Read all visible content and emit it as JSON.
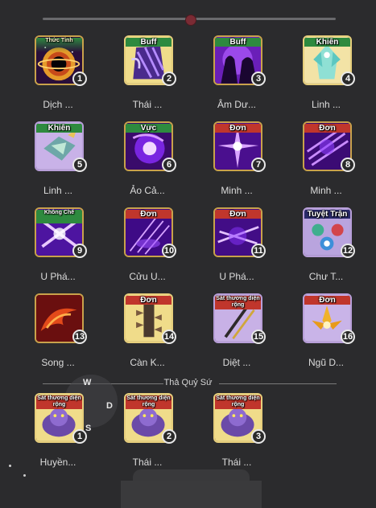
{
  "colors": {
    "background": "#2b2b2d",
    "badge_border": "#e8e8e8",
    "tile_border": "#c9a24b",
    "tag_red": "#c0362c",
    "tag_green": "#2e8a3f"
  },
  "skills_top": [
    {
      "tag": "Thức Tỉnh",
      "level": "1",
      "name": "Dịch ...",
      "icon": "black-hole-icon"
    },
    {
      "tag": "Buff",
      "level": "2",
      "name": "Thái ...",
      "icon": "ghost-claw-icon"
    },
    {
      "tag": "Buff",
      "level": "3",
      "name": "Âm Dư...",
      "icon": "shadow-duo-icon"
    },
    {
      "tag": "Khiên",
      "level": "4",
      "name": "Linh ...",
      "icon": "crystal-guardian-icon"
    },
    {
      "tag": "Khiên",
      "level": "5",
      "name": "Linh ...",
      "icon": "crystal-fish-icon"
    },
    {
      "tag": "Vực",
      "level": "6",
      "name": "Ảo Cả...",
      "icon": "vortex-icon"
    },
    {
      "tag": "Đơn",
      "level": "7",
      "name": "Minh ...",
      "icon": "void-burst-icon"
    },
    {
      "tag": "Đơn",
      "level": "8",
      "name": "Minh ...",
      "icon": "claw-strike-icon"
    },
    {
      "tag": "Không Chế",
      "level": "9",
      "name": "U Phá...",
      "icon": "cross-slash-icon"
    },
    {
      "tag": "Đơn",
      "level": "10",
      "name": "Cửu U...",
      "icon": "needle-rain-icon"
    },
    {
      "tag": "Đơn",
      "level": "11",
      "name": "U Phá...",
      "icon": "blade-cross-icon"
    },
    {
      "tag": "Tuyệt Trận",
      "level": "12",
      "name": "Chư T...",
      "icon": "formation-orbs-icon"
    },
    {
      "tag": "",
      "level": "13",
      "name": "Song ...",
      "icon": "fire-swirl-icon"
    },
    {
      "tag": "Đơn",
      "level": "14",
      "name": "Càn K...",
      "icon": "spiked-tower-icon"
    },
    {
      "tag": "Sát thương diện rộng",
      "level": "15",
      "name": "Diệt ...",
      "icon": "twin-blades-icon"
    },
    {
      "tag": "Đơn",
      "level": "16",
      "name": "Ngũ D...",
      "icon": "golden-lotus-icon"
    }
  ],
  "section": {
    "title": "Thả Quỷ Sứ"
  },
  "joystick": {
    "w": "W",
    "d": "D",
    "s": "S"
  },
  "skills_bottom": [
    {
      "tag": "Sát thương diện rộng",
      "level": "1",
      "name": "Huyền...",
      "icon": "purple-beast-icon"
    },
    {
      "tag": "Sát thương diện rộng",
      "level": "2",
      "name": "Thái ...",
      "icon": "purple-beast-icon"
    },
    {
      "tag": "Sát thương diện rộng",
      "level": "3",
      "name": "Thái ...",
      "icon": "purple-beast-icon"
    }
  ]
}
